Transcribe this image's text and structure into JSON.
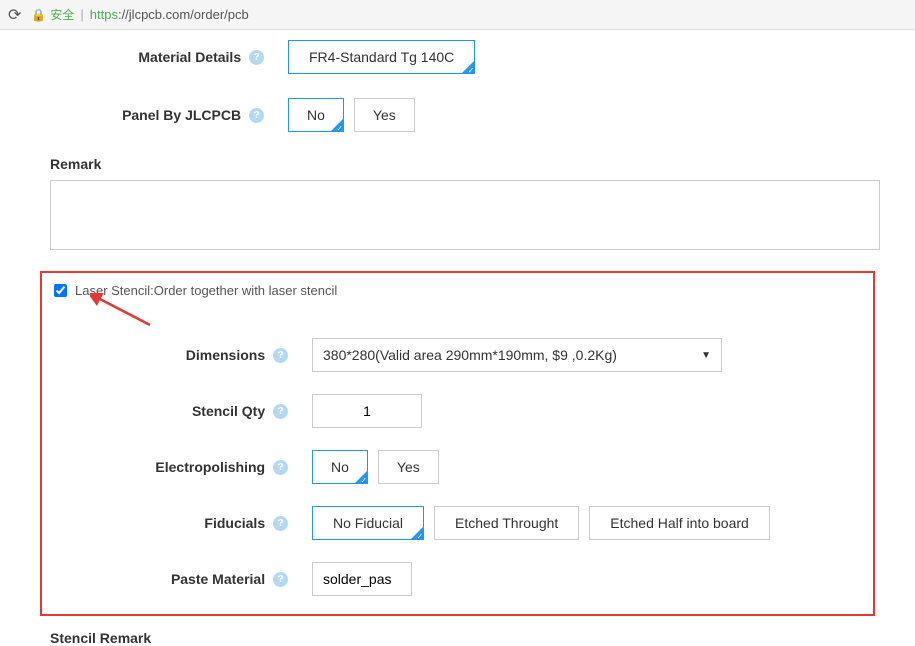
{
  "browser": {
    "secure_label": "安全",
    "url_https": "https",
    "url_rest": "://jlcpcb.com/order/pcb"
  },
  "form": {
    "material_details": {
      "label": "Material Details",
      "options": [
        "FR4-Standard Tg 140C"
      ],
      "selected": "FR4-Standard Tg 140C"
    },
    "panel_by_jlcpcb": {
      "label": "Panel By JLCPCB",
      "options": {
        "no": "No",
        "yes": "Yes"
      },
      "selected": "No"
    },
    "remark": {
      "label": "Remark",
      "value": ""
    }
  },
  "stencil": {
    "checked": true,
    "title": "Laser Stencil:Order together with laser stencil",
    "dimensions": {
      "label": "Dimensions",
      "selected": "380*280(Valid area 290mm*190mm, $9 ,0.2Kg)"
    },
    "qty": {
      "label": "Stencil Qty",
      "value": "1"
    },
    "electropolishing": {
      "label": "Electropolishing",
      "options": {
        "no": "No",
        "yes": "Yes"
      },
      "selected": "No"
    },
    "fiducials": {
      "label": "Fiducials",
      "options": {
        "none": "No Fiducial",
        "through": "Etched Throught",
        "half": "Etched Half into board"
      },
      "selected": "No Fiducial"
    },
    "paste_material": {
      "label": "Paste Material",
      "value": "solder_pas"
    }
  },
  "stencil_remark_label": "Stencil Remark"
}
